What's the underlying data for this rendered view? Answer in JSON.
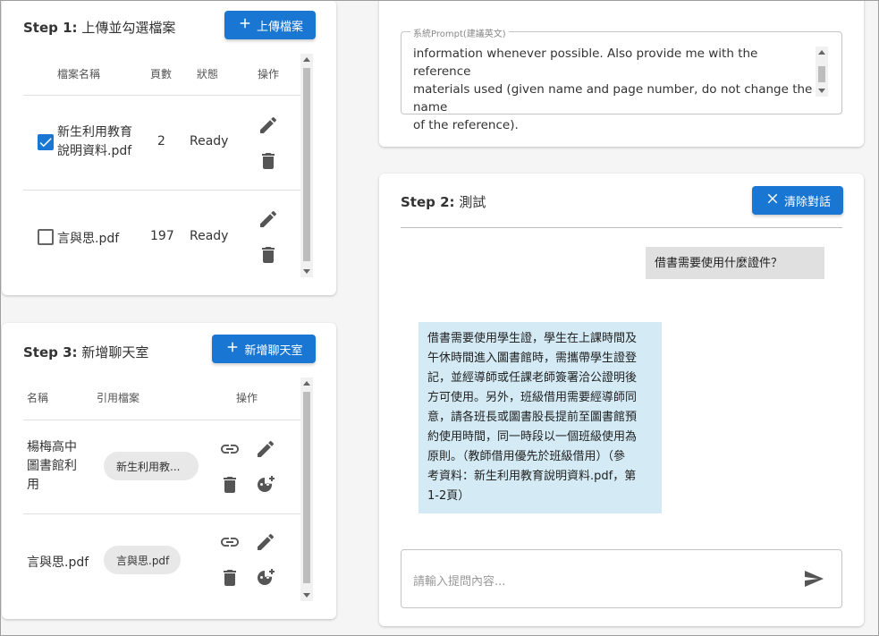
{
  "step1": {
    "title_prefix": "Step 1:",
    "title_text": "上傳並勾選檔案",
    "upload_button": "上傳檔案",
    "columns": [
      "檔案名稱",
      "頁數",
      "狀態",
      "操作"
    ],
    "rows": [
      {
        "name_line1": "新生利用教育",
        "name_line2": "說明資料.pdf",
        "pages": "2",
        "status": "Ready",
        "checked": true
      },
      {
        "name_line1": "言與思.pdf",
        "name_line2": "",
        "pages": "197",
        "status": "Ready",
        "checked": false
      }
    ]
  },
  "step3": {
    "title_prefix": "Step 3:",
    "title_text": "新增聊天室",
    "add_button": "新增聊天室",
    "columns": [
      "名稱",
      "引用檔案",
      "操作"
    ],
    "rows": [
      {
        "name_line1": "楊梅高中",
        "name_line2": "圖書館利",
        "name_line3": "用",
        "file_chip": "新生利用教..."
      },
      {
        "name_line1": "言與思.pdf",
        "name_line2": "",
        "name_line3": "",
        "file_chip": "言與思.pdf"
      }
    ]
  },
  "system_prompt": {
    "label": "系統Prompt(建議英文)",
    "value": "information whenever possible. Also provide me with the reference\nmaterials used (given name and page number, do not change the name\nof the reference)."
  },
  "step2": {
    "title_prefix": "Step 2:",
    "title_text": "測試",
    "clear_button": "清除對話",
    "user_message": "借書需要使用什麼證件？",
    "bot_lines": [
      "借書需要使用學生證，學生在上課時間及",
      "午休時間進入圖書館時，需攜帶學生證登",
      "記，並經導師或任課老師簽署洽公證明後",
      "方可使用。另外，班級借用需要經導師同",
      "意，請各班長或圖書股長提前至圖書館預",
      "約使用時間，同一時段以一個班級使用為",
      "原則。（教師借用優先於班級借用）（參",
      "考資料：新生利用教育說明資料.pdf，第",
      "1-2頁）"
    ],
    "input_placeholder": "請輸入提問內容..."
  },
  "colors": {
    "primary": "#1976d2",
    "bot_bubble": "#d4ebf5",
    "user_bubble": "#e0e0e0",
    "background": "#f5f5f5"
  },
  "icons": [
    "plus-icon",
    "edit-icon",
    "delete-icon",
    "link-icon",
    "add-emoji-icon",
    "close-icon",
    "send-icon",
    "check-icon"
  ]
}
